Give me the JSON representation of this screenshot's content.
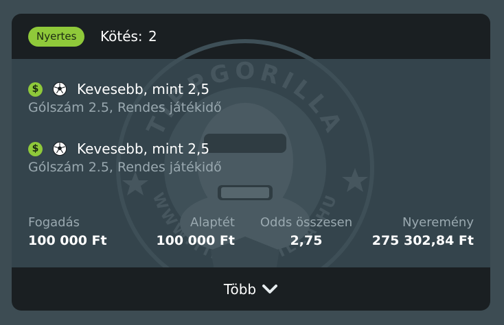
{
  "header": {
    "status_badge": "Nyertes",
    "bet_count_label": "Kötés:",
    "bet_count": "2"
  },
  "watermark": {
    "text_top": "TIPPGORILLA",
    "text_bottom": "WWW.TIPPGORILLA.HU"
  },
  "bets": [
    {
      "title": "Kevesebb, mint 2,5",
      "subtitle": "Gólszám 2.5, Rendes játékidő",
      "icons": [
        "dollar-icon",
        "soccer-ball-icon"
      ]
    },
    {
      "title": "Kevesebb, mint 2,5",
      "subtitle": "Gólszám 2.5, Rendes játékidő",
      "icons": [
        "dollar-icon",
        "soccer-ball-icon"
      ]
    }
  ],
  "summary": {
    "stake": {
      "label": "Fogadás",
      "value": "100 000 Ft"
    },
    "base_stake": {
      "label": "Alaptét",
      "value": "100 000 Ft"
    },
    "total_odds": {
      "label": "Odds összesen",
      "value": "2,75"
    },
    "winnings": {
      "label": "Nyeremény",
      "value": "275 302,84 Ft"
    }
  },
  "footer": {
    "more_label": "Több"
  },
  "colors": {
    "accent_green": "#8fc93a",
    "card_bg": "#34444c",
    "header_bg": "#1a1f22",
    "muted_text": "#9aa9b0"
  }
}
